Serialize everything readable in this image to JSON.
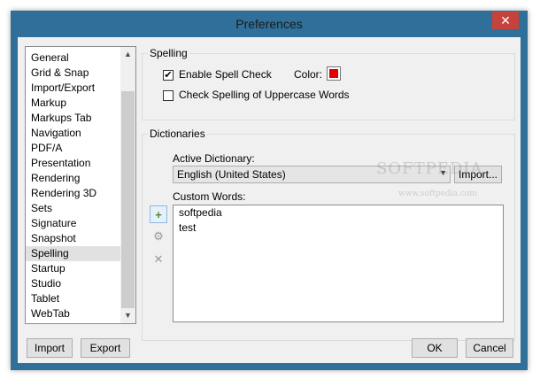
{
  "window": {
    "title": "Preferences",
    "close_glyph": "✕"
  },
  "sidebar": {
    "items": [
      {
        "label": "General"
      },
      {
        "label": "Grid & Snap"
      },
      {
        "label": "Import/Export"
      },
      {
        "label": "Markup"
      },
      {
        "label": "Markups Tab"
      },
      {
        "label": "Navigation"
      },
      {
        "label": "PDF/A"
      },
      {
        "label": "Presentation"
      },
      {
        "label": "Rendering"
      },
      {
        "label": "Rendering 3D"
      },
      {
        "label": "Sets"
      },
      {
        "label": "Signature"
      },
      {
        "label": "Snapshot"
      },
      {
        "label": "Spelling",
        "selected": true
      },
      {
        "label": "Startup"
      },
      {
        "label": "Studio"
      },
      {
        "label": "Tablet"
      },
      {
        "label": "WebTab"
      }
    ],
    "scroll_up": "▲",
    "scroll_down": "▼"
  },
  "spelling": {
    "group_label": "Spelling",
    "enable_label": "Enable Spell Check",
    "enable_checked": "✔",
    "color_label": "Color:",
    "color_value": "#e00000",
    "uppercase_label": "Check Spelling of Uppercase Words"
  },
  "dictionaries": {
    "group_label": "Dictionaries",
    "active_label": "Active Dictionary:",
    "active_value": "English (United States)",
    "combo_arrow": "▼",
    "import_button": "Import...",
    "custom_label": "Custom Words:",
    "words": [
      "softpedia",
      "test"
    ],
    "add_glyph": "+",
    "settings_glyph": "⚙",
    "delete_glyph": "✕"
  },
  "footer": {
    "import_button": "Import",
    "export_button": "Export",
    "ok_button": "OK",
    "cancel_button": "Cancel"
  },
  "watermark": {
    "logo": "SOFTPEDIA",
    "url": "www.softpedia.com"
  }
}
